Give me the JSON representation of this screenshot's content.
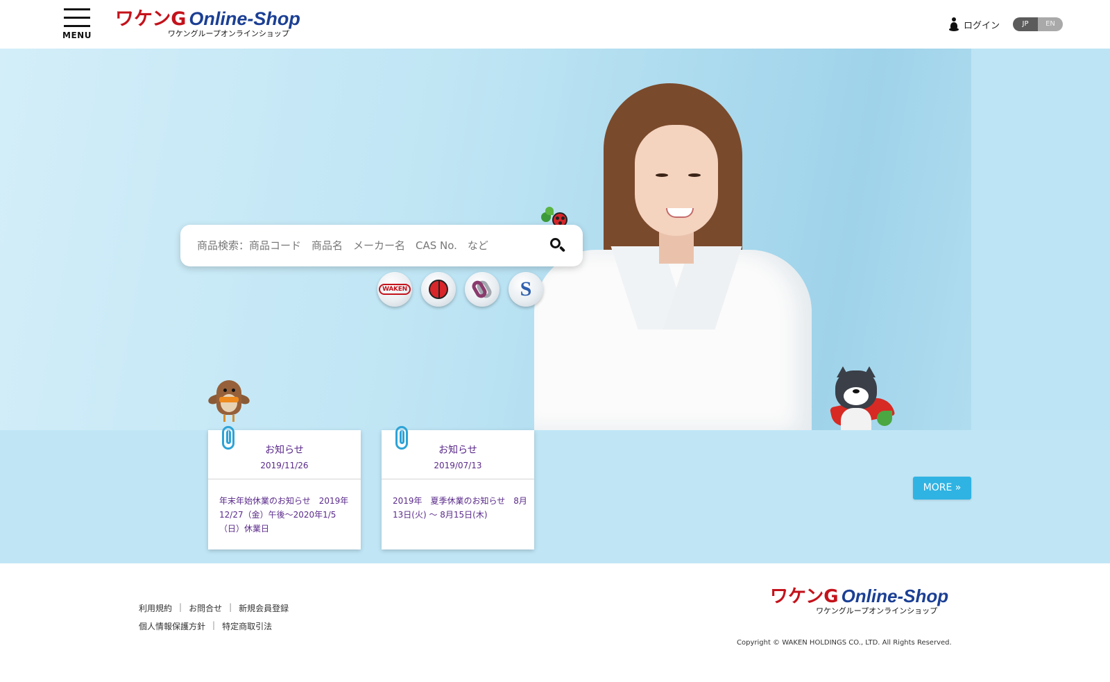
{
  "header": {
    "menu_label": "MENU",
    "logo": {
      "main_jp": "ワケンG",
      "main_en": "Online-Shop",
      "sub": "ワケングループオンラインショップ"
    },
    "login_label": "ログイン",
    "lang": {
      "jp": "JP",
      "en": "EN",
      "selected": "JP"
    }
  },
  "hero": {
    "search": {
      "placeholder": "商品検索：商品コード　商品名　メーカー名　CAS No.　など"
    },
    "companies": [
      {
        "name": "WAKEN",
        "icon": "waken-logo-icon"
      },
      {
        "name": "ladybug",
        "icon": "ladybug-logo-icon"
      },
      {
        "name": "knot",
        "icon": "knot-logo-icon"
      },
      {
        "name": "SHINKOKU",
        "icon": "shinkoku-logo-icon"
      }
    ],
    "company_label_waken": "WAKEN",
    "company_label_shinkoku": "S"
  },
  "news": {
    "items": [
      {
        "title": "お知らせ",
        "date": "2019/11/26",
        "body": "年末年始休業のお知らせ　2019年12/27（金）午後～2020年1/5（日）休業日"
      },
      {
        "title": "お知らせ",
        "date": "2019/07/13",
        "body": "2019年　夏季休業のお知らせ　8月13日(火) ～ 8月15日(木)"
      }
    ],
    "more_label": "MORE »"
  },
  "footer": {
    "links_row1": [
      "利用規約",
      "お問合せ",
      "新規会員登録"
    ],
    "links_row2": [
      "個人情報保護方針",
      "特定商取引法"
    ],
    "separator": "|",
    "logo": {
      "main_jp": "ワケンG",
      "main_en": "Online-Shop",
      "sub": "ワケングループオンラインショップ"
    },
    "copyright": "Copyright © WAKEN HOLDINGS CO., LTD. All Rights Reserved."
  },
  "colors": {
    "brand_red": "#c4121b",
    "brand_blue": "#1b3f94",
    "accent": "#2fb3e3",
    "news_text": "#5a2a8a",
    "strip_bg": "#c0e6f6"
  }
}
